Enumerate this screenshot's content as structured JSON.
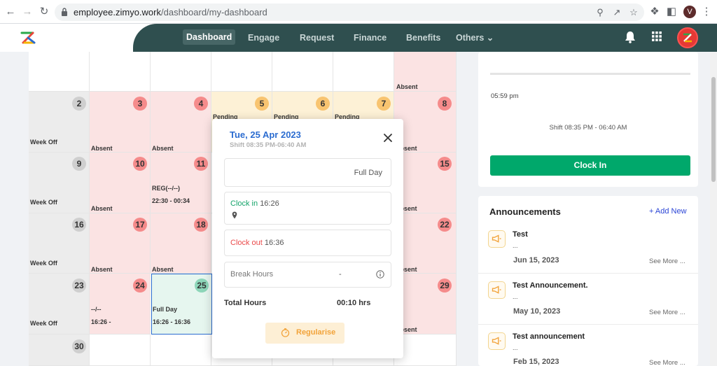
{
  "browser": {
    "url_host": "employee.zimyo.work",
    "url_path": "/dashboard/my-dashboard",
    "profile_initial": "V"
  },
  "nav": {
    "items": [
      {
        "label": "Dashboard"
      },
      {
        "label": "Engage"
      },
      {
        "label": "Request"
      },
      {
        "label": "Finance"
      },
      {
        "label": "Benefits"
      },
      {
        "label": "Others"
      }
    ]
  },
  "calendar": {
    "row0": {
      "label_absent": "Absent"
    },
    "row1": [
      {
        "day": "2",
        "status": "Week Off"
      },
      {
        "day": "3",
        "status": "Absent"
      },
      {
        "day": "4",
        "status": "Absent"
      },
      {
        "day": "5",
        "status": "Pending"
      },
      {
        "day": "6",
        "status": "Pending"
      },
      {
        "day": "7",
        "status": "Pending"
      },
      {
        "day": "8",
        "status": "Absent"
      }
    ],
    "row2": [
      {
        "day": "9",
        "status": "Week Off"
      },
      {
        "day": "10",
        "status": "Absent"
      },
      {
        "day": "11",
        "status": "REG(--/--)",
        "time": "22:30 - 00:34"
      },
      {
        "day": "15",
        "status": "Absent"
      }
    ],
    "row3": [
      {
        "day": "16",
        "status": "Week Off"
      },
      {
        "day": "17",
        "status": "Absent"
      },
      {
        "day": "18",
        "status": "Absent"
      },
      {
        "day": "22",
        "status": "Absent"
      }
    ],
    "row4": [
      {
        "day": "23",
        "status": "Week Off"
      },
      {
        "day": "24",
        "status": "--/--",
        "time": "16:26 -"
      },
      {
        "day": "25",
        "status": "Full Day",
        "time": "16:26 - 16:36"
      },
      {
        "day": "29",
        "status": "Absent"
      }
    ],
    "row5": [
      {
        "day": "30"
      }
    ]
  },
  "modal": {
    "date": "Tue, 25 Apr 2023",
    "shift": "Shift 08:35 PM-06:40 AM",
    "day_type": "Full Day",
    "clock_in_label": "Clock in",
    "clock_in_time": "16:26",
    "clock_out_label": "Clock out",
    "clock_out_time": "16:36",
    "break_label": "Break Hours",
    "break_value": "-",
    "total_label": "Total Hours",
    "total_value": "00:10 hrs",
    "regularise_label": "Regularise"
  },
  "clock_card": {
    "time": "05:59 pm",
    "shift": "Shift 08:35 PM - 06:40 AM",
    "button_label": "Clock In"
  },
  "announcements": {
    "title": "Announcements",
    "add_label": "+ Add New",
    "see_more_label": "See More ...",
    "items": [
      {
        "title": "Test",
        "body": "...",
        "date": "Jun 15, 2023"
      },
      {
        "title": "Test Announcement.",
        "body": "...",
        "date": "May 10, 2023"
      },
      {
        "title": "Test announcement",
        "body": "...",
        "date": "Feb 15, 2023"
      }
    ]
  },
  "colors": {
    "nav_bg": "#2f4f4f",
    "accent_blue": "#2b6cd0",
    "clock_in_green": "#00a86b",
    "absent_red": "#fbe3e3",
    "pending_orange": "#fdf1d6"
  }
}
